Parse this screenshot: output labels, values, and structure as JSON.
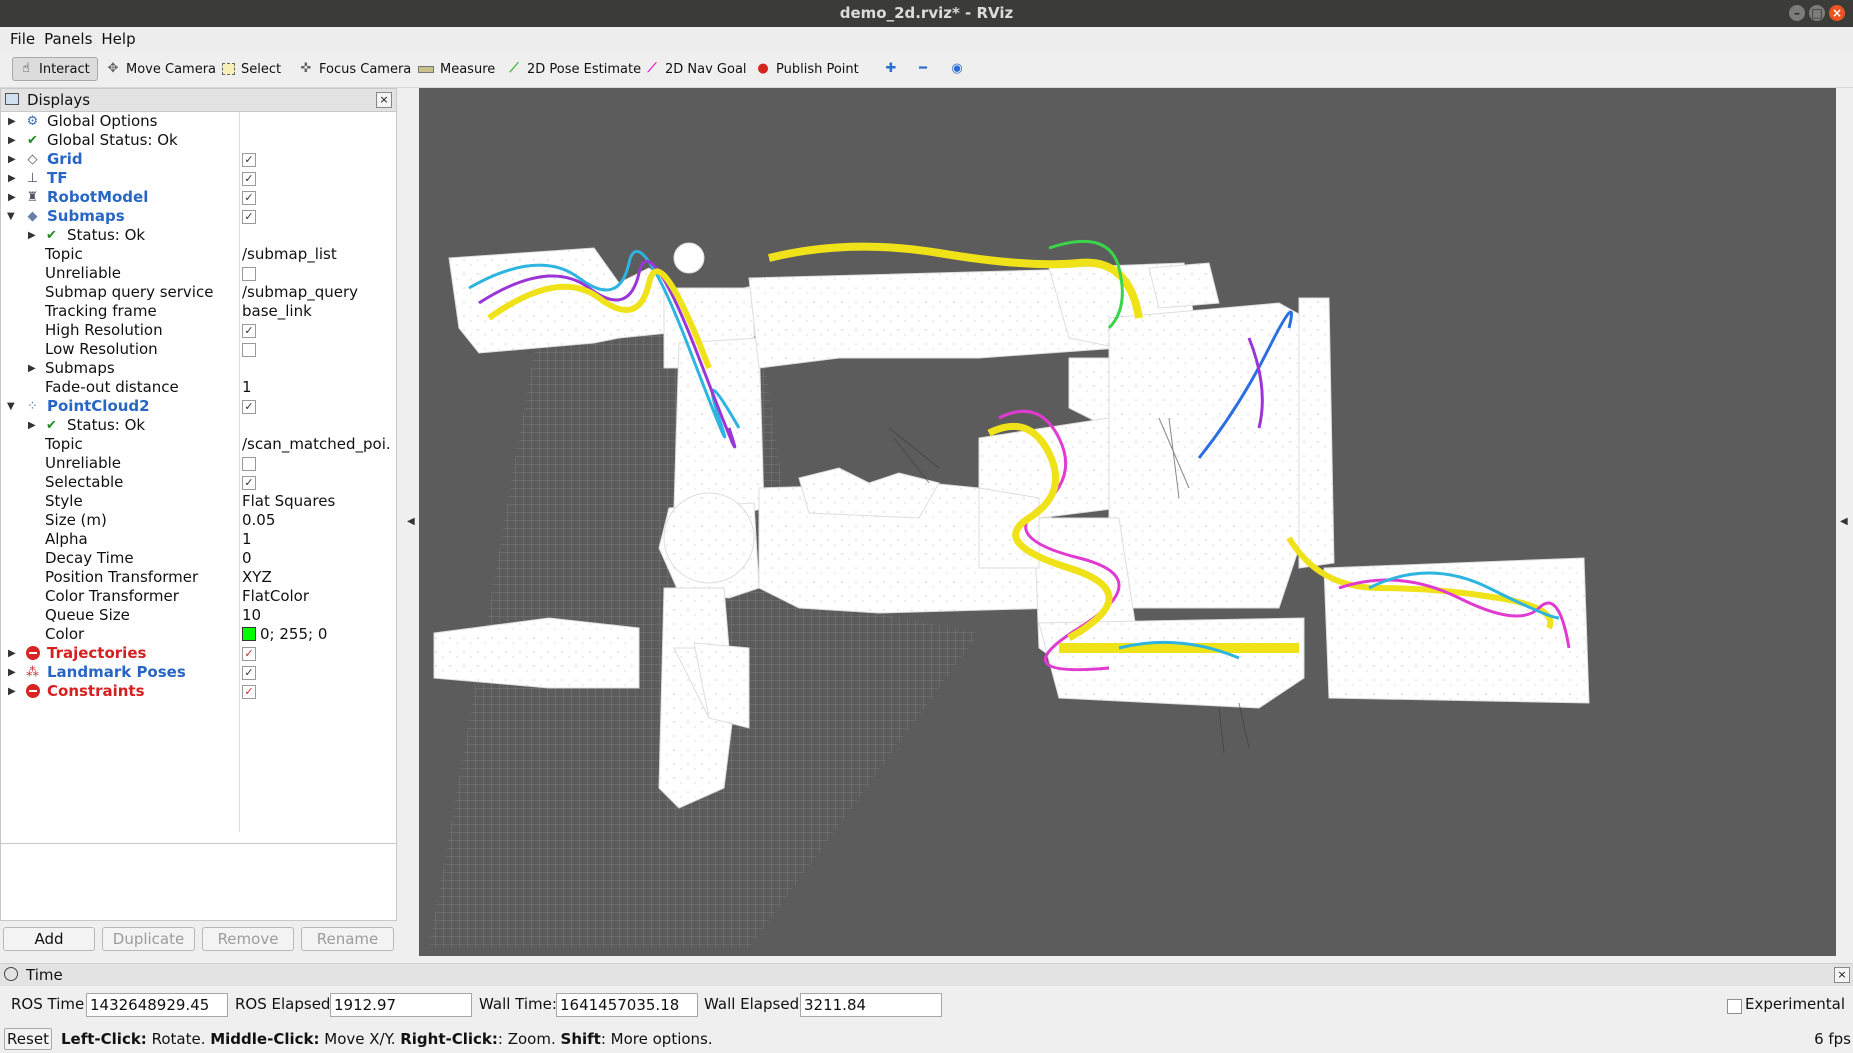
{
  "window": {
    "title": "demo_2d.rviz* - RViz"
  },
  "menu": {
    "file": "File",
    "panels": "Panels",
    "help": "Help"
  },
  "toolbar": {
    "interact": "Interact",
    "move_camera": "Move Camera",
    "select": "Select",
    "focus_camera": "Focus Camera",
    "measure": "Measure",
    "pose_estimate": "2D Pose Estimate",
    "nav_goal": "2D Nav Goal",
    "publish_point": "Publish Point"
  },
  "displays": {
    "title": "Displays",
    "items": {
      "global_options": "Global Options",
      "global_status": "Global Status: Ok",
      "grid": "Grid",
      "tf": "TF",
      "robot_model": "RobotModel",
      "submaps": "Submaps",
      "submaps_status": "Status: Ok",
      "submaps_topic_label": "Topic",
      "submaps_topic": "/submap_list",
      "unreliable": "Unreliable",
      "query_label": "Submap query service",
      "query_value": "/submap_query",
      "tracking_label": "Tracking frame",
      "tracking_value": "base_link",
      "high_res": "High Resolution",
      "low_res": "Low Resolution",
      "submaps_child": "Submaps",
      "fade_label": "Fade-out distance",
      "fade_value": "1",
      "pointcloud": "PointCloud2",
      "pc_status": "Status: Ok",
      "pc_topic_label": "Topic",
      "pc_topic": "/scan_matched_poi...",
      "pc_unreliable": "Unreliable",
      "selectable": "Selectable",
      "style_label": "Style",
      "style_value": "Flat Squares",
      "size_label": "Size (m)",
      "size_value": "0.05",
      "alpha_label": "Alpha",
      "alpha_value": "1",
      "decay_label": "Decay Time",
      "decay_value": "0",
      "pos_tf_label": "Position Transformer",
      "pos_tf_value": "XYZ",
      "color_tf_label": "Color Transformer",
      "color_tf_value": "FlatColor",
      "queue_label": "Queue Size",
      "queue_value": "10",
      "color_label": "Color",
      "color_value": "0; 255; 0",
      "trajectories": "Trajectories",
      "landmarks": "Landmark Poses",
      "constraints": "Constraints"
    },
    "buttons": {
      "add": "Add",
      "duplicate": "Duplicate",
      "remove": "Remove",
      "rename": "Rename"
    }
  },
  "time": {
    "title": "Time",
    "ros_time_label": "ROS Time:",
    "ros_time": "1432648929.45",
    "ros_elapsed_label": "ROS Elapsed:",
    "ros_elapsed": "1912.97",
    "wall_time_label": "Wall Time:",
    "wall_time": "1641457035.18",
    "wall_elapsed_label": "Wall Elapsed:",
    "wall_elapsed": "3211.84",
    "experimental": "Experimental"
  },
  "status": {
    "reset": "Reset",
    "left_click": "Left-Click:",
    "left_text": " Rotate. ",
    "middle_click": "Middle-Click:",
    "middle_text": " Move X/Y. ",
    "right_click": "Right-Click:",
    "right_text": ": Zoom. ",
    "shift": "Shift",
    "shift_text": ": More options.",
    "fps": "6 fps"
  },
  "colors": {
    "viewport_bg": "#5c5c5c",
    "map_free": "#ffffff",
    "accent_blue": "#2866c4",
    "error_red": "#d62020",
    "pointcloud_green": "#00ff00"
  }
}
